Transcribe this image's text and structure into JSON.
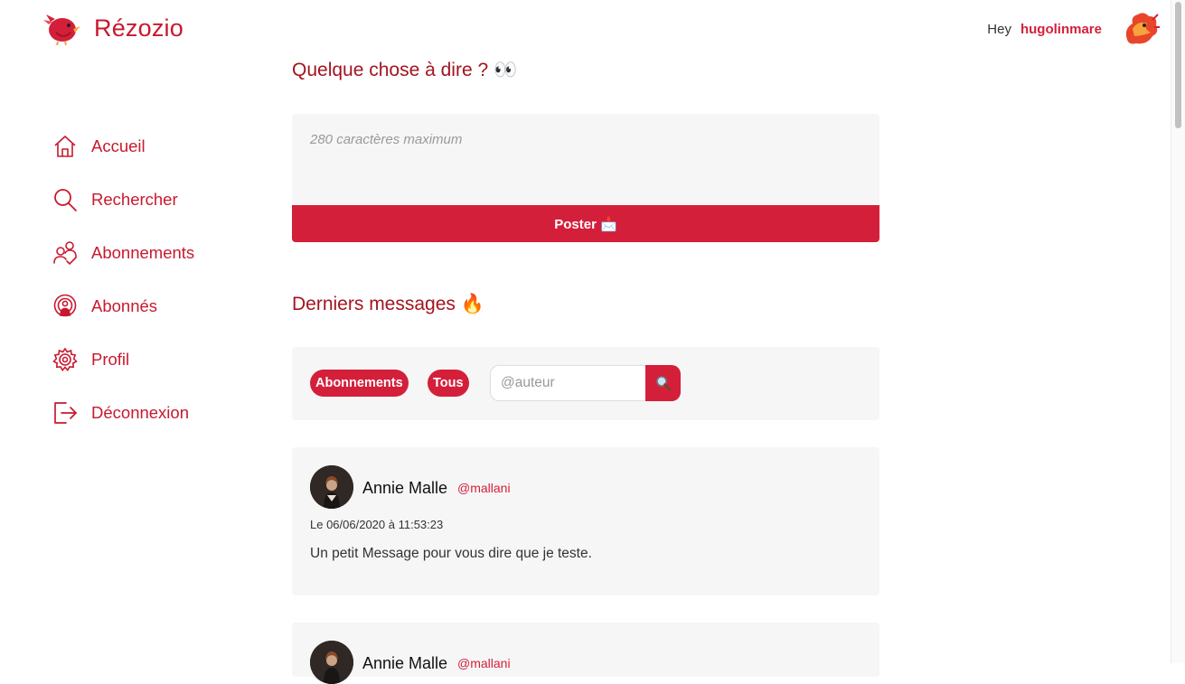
{
  "brand": {
    "name": "Rézozio"
  },
  "header": {
    "greeting": "Hey",
    "username": "hugolinmare"
  },
  "nav": {
    "items": [
      {
        "label": "Accueil",
        "icon": "home-icon"
      },
      {
        "label": "Rechercher",
        "icon": "search-icon"
      },
      {
        "label": "Abonnements",
        "icon": "users-check-icon"
      },
      {
        "label": "Abonnés",
        "icon": "broadcast-icon"
      },
      {
        "label": "Profil",
        "icon": "gear-icon"
      },
      {
        "label": "Déconnexion",
        "icon": "logout-icon"
      }
    ]
  },
  "compose": {
    "title": "Quelque chose à dire ? 👀",
    "placeholder": "280 caractères maximum",
    "value": "",
    "submit_label": "Poster 📩"
  },
  "feed": {
    "title": "Derniers messages 🔥",
    "filters": {
      "subscriptions_label": "Abonnements",
      "all_label": "Tous"
    },
    "author_search": {
      "placeholder": "@auteur",
      "value": "",
      "button_icon": "magnifier-icon"
    },
    "messages": [
      {
        "author": "Annie Malle",
        "handle": "@mallani",
        "date": "Le 06/06/2020 à 11:53:23",
        "text": "Un petit Message pour vous dire que je teste."
      },
      {
        "author": "Annie Malle",
        "handle": "@mallani"
      }
    ]
  },
  "colors": {
    "accent": "#d41f3a",
    "heading": "#a3141f",
    "panel": "#f6f6f6"
  }
}
